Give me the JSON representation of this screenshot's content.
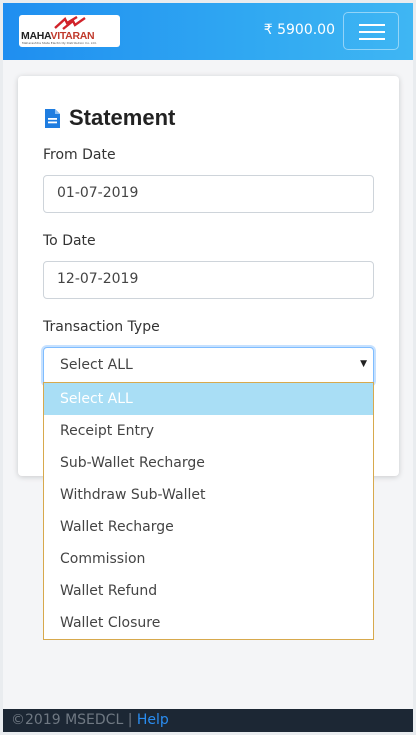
{
  "header": {
    "logo_word_a": "MAHA",
    "logo_word_b": "VITARAN",
    "logo_tagline": "Maharashtra State Electricity Distribution Co. Ltd.",
    "balance": "₹ 5900.00"
  },
  "statement": {
    "title": "Statement",
    "from_label": "From Date",
    "from_value": "01-07-2019",
    "to_label": "To Date",
    "to_value": "12-07-2019",
    "type_label": "Transaction Type",
    "type_value": "Select ALL"
  },
  "dropdown": {
    "options": [
      "Select ALL",
      "Receipt Entry",
      "Sub-Wallet Recharge",
      "Withdraw Sub-Wallet",
      "Wallet Recharge",
      "Commission",
      "Wallet Refund",
      "Wallet Closure"
    ]
  },
  "footer": {
    "copyright": "©2019 MSEDCL | ",
    "help": "Help"
  },
  "colors": {
    "navbar": "#1f8ef0",
    "accent": "#1f7de0",
    "selected_option": "#a9def5",
    "footer_bg": "#1c2734"
  },
  "icons": {
    "title_icon": "document-icon",
    "menu_icon": "hamburger-menu-icon",
    "logo_icon": "lightning-bolt-icon"
  }
}
